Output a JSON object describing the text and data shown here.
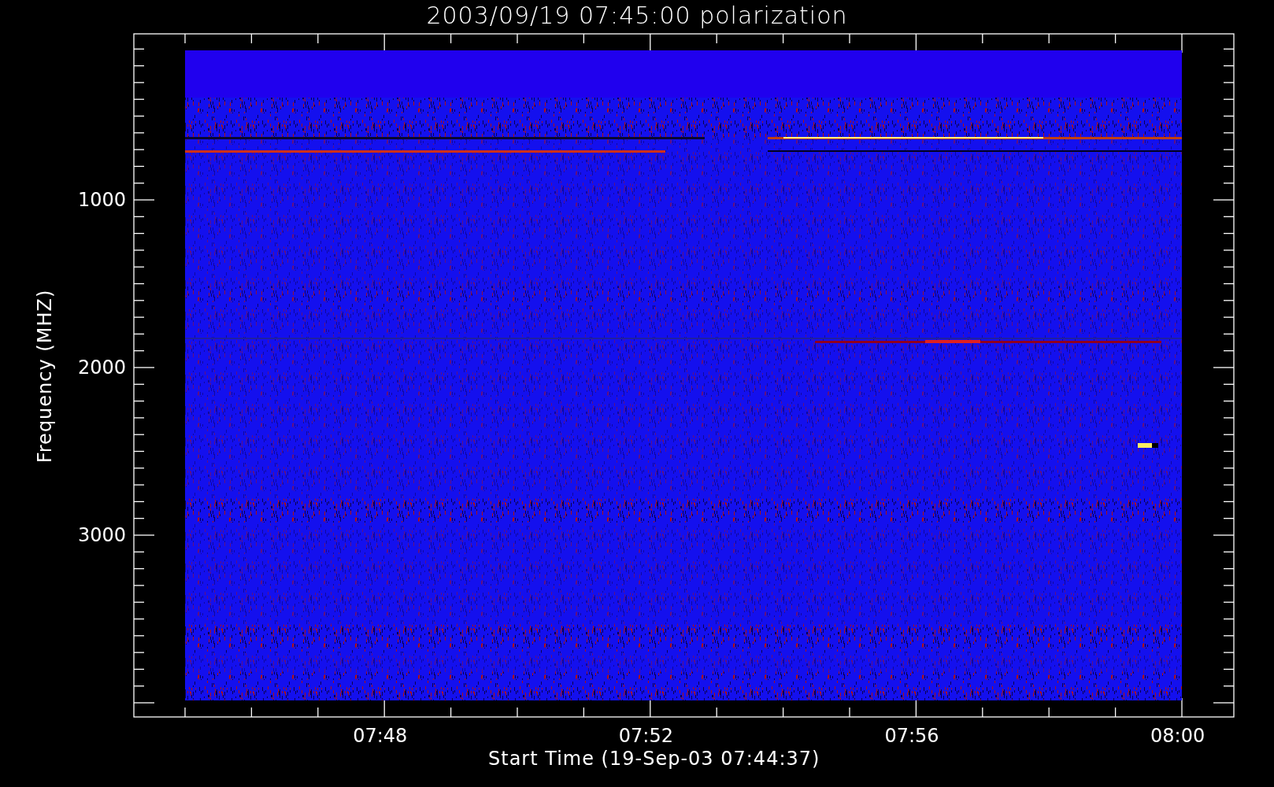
{
  "title": "2003/09/19 07:45:00 polarization",
  "y_axis": {
    "label": "Frequency (MHZ)",
    "ticks": [
      "1000",
      "2000",
      "3000"
    ]
  },
  "x_axis": {
    "label": "Start Time (19-Sep-03 07:44:37)",
    "ticks": [
      "07:48",
      "07:52",
      "07:56",
      "08:00"
    ]
  }
}
